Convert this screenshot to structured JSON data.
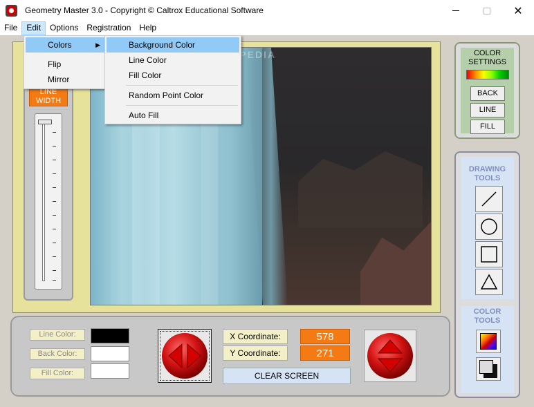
{
  "window": {
    "title": "Geometry Master 3.0  -  Copyright © Caltrox Educational Software",
    "minimize_icon": "minimize-icon",
    "maximize_icon": "maximize-icon",
    "close_glyph": "✕"
  },
  "menubar": {
    "items": [
      {
        "label": "File"
      },
      {
        "label": "Edit"
      },
      {
        "label": "Options"
      },
      {
        "label": "Registration"
      },
      {
        "label": "Help"
      }
    ]
  },
  "edit_menu": {
    "items": [
      {
        "label": "Colors"
      },
      {
        "label": "Flip"
      },
      {
        "label": "Mirror"
      }
    ]
  },
  "colors_submenu": {
    "items": [
      {
        "label": "Background Color"
      },
      {
        "label": "Line Color"
      },
      {
        "label": "Fill Color"
      },
      {
        "label": "Random Point Color"
      },
      {
        "label": "Auto Fill"
      }
    ]
  },
  "left_panel": {
    "line_width_label": "LINE\nWIDTH"
  },
  "canvas": {
    "watermark": "SOFTPEDIA"
  },
  "color_settings": {
    "title": "COLOR SETTINGS",
    "buttons": [
      {
        "label": "BACK"
      },
      {
        "label": "LINE"
      },
      {
        "label": "FILL"
      }
    ]
  },
  "drawing_tools": {
    "title": "DRAWING TOOLS",
    "tools": [
      "line-icon",
      "circle-icon",
      "square-icon",
      "triangle-icon"
    ]
  },
  "color_tools": {
    "title": "COLOR TOOLS",
    "tools": [
      "palette-icon",
      "fill-icon"
    ]
  },
  "bottom": {
    "line_color_label": "Line Color:",
    "back_color_label": "Back Color:",
    "fill_color_label": "Fill Color:",
    "line_color": "#000000",
    "back_color": "#ffffff",
    "fill_color": "#ffffff",
    "x_label": "X Coordinate:",
    "y_label": "Y Coordinate:",
    "x_value": "578",
    "y_value": "271",
    "clear_label": "CLEAR SCREEN"
  },
  "colors": {
    "accent_orange": "#f47a14",
    "canvas_frame": "#e6e29b",
    "menu_highlight": "#91c9f7"
  }
}
